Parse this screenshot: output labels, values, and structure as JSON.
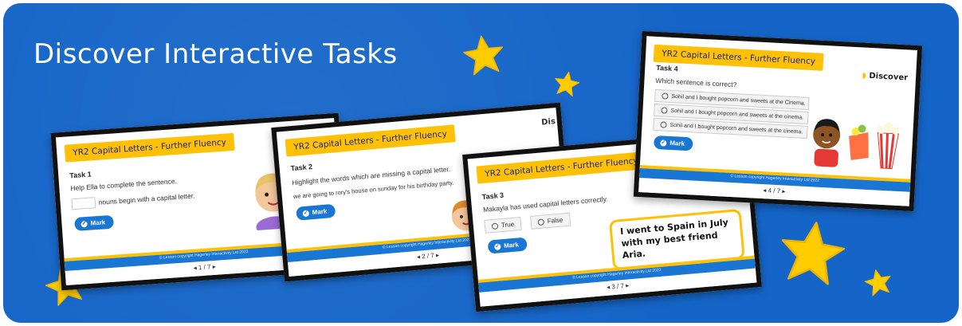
{
  "headline": "Discover Interactive Tasks",
  "colors": {
    "banner": "#1565c8",
    "star": "#ffcc00",
    "title_bar": "#ffc107",
    "button": "#1976d2"
  },
  "copyright": "© Lesson copyright Hagerley Interactivity Ltd 2022",
  "slides": [
    {
      "title": "YR2 Capital Letters - Further Fluency",
      "task": "Task 1",
      "instruction": "Help Ella to complete the sentence.",
      "sentence_after_blank": "nouns begin with a capital letter.",
      "button": "Mark",
      "pager": "1 / 7",
      "character": "girl-with-bun"
    },
    {
      "title": "YR2 Capital Letters - Further Fluency",
      "task": "Task 2",
      "instruction": "Highlight the words which are missing a capital letter.",
      "sentence": "we are going to rory's house on sunday for his birthday party.",
      "button": "Mark",
      "pager": "2 / 7",
      "logo_fragment": "Dis",
      "character": "boy-with-balloons"
    },
    {
      "title": "YR2 Capital Letters - Further Fluency",
      "task": "Task 3",
      "instruction": "Makayla has used capital letters correctly.",
      "options": [
        "True",
        "False"
      ],
      "speech": "I went to Spain in July with my best friend Aria.",
      "button": "Mark",
      "pager": "3 / 7"
    },
    {
      "title": "YR2 Capital Letters - Further Fluency",
      "task": "Task 4",
      "question": "Which sentence is correct?",
      "options": [
        "Sohil and I bought popcorn and sweets at the Cinema.",
        "Sohil and I bought popcorn and sweets at the cinema.",
        "Sohil and I bought popcorn and sweets at the cinema."
      ],
      "button": "Mark",
      "pager": "4 / 7",
      "logo": "Discover",
      "character": "boy-with-popcorn"
    }
  ]
}
